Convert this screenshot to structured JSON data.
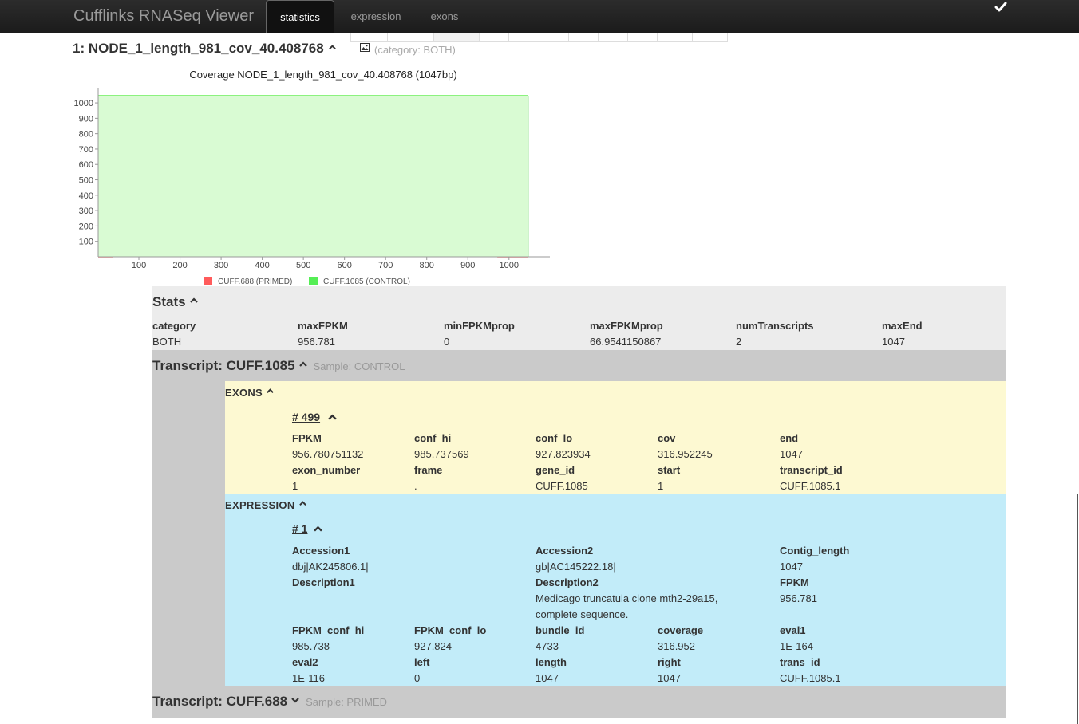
{
  "navbar": {
    "brand": "Cufflinks RNASeq Viewer",
    "tabs": [
      "statistics",
      "expression",
      "exons"
    ],
    "active_tab": "statistics",
    "check_icon": "check-icon"
  },
  "node": {
    "title": "1: NODE_1_length_981_cov_40.408768",
    "category": "(category: BOTH)"
  },
  "chart_data": {
    "type": "line",
    "title": "Coverage NODE_1_length_981_cov_40.408768 (1047bp)",
    "xlim": [
      1,
      1047
    ],
    "ylim": [
      0,
      1047
    ],
    "x_ticks": [
      100,
      200,
      300,
      400,
      500,
      600,
      700,
      800,
      900,
      1000
    ],
    "y_ticks": [
      100,
      200,
      300,
      400,
      500,
      600,
      700,
      800,
      900,
      1000
    ],
    "legend_position": "bottom",
    "series": [
      {
        "name": "CUFF.688 (PRIMED)",
        "color": "#ff5b5b",
        "x": [
          1,
          36,
          36,
          973,
          973,
          1047
        ],
        "y": [
          0,
          0,
          7,
          7,
          0,
          0
        ]
      },
      {
        "name": "CUFF.1085 (CONTROL)",
        "color": "#66ee55",
        "fill": "#d9fbd3",
        "x": [
          1,
          1047
        ],
        "y": [
          1047,
          1047
        ]
      }
    ]
  },
  "stats": {
    "heading": "Stats",
    "columns": [
      {
        "label": "category",
        "value": "BOTH"
      },
      {
        "label": "maxFPKM",
        "value": "956.781"
      },
      {
        "label": "minFPKMprop",
        "value": "0"
      },
      {
        "label": "maxFPKMprop",
        "value": "66.9541150867"
      },
      {
        "label": "numTranscripts",
        "value": "2"
      },
      {
        "label": "maxEnd",
        "value": "1047"
      }
    ]
  },
  "transcript1": {
    "title": "Transcript: CUFF.1085",
    "sample": "Sample: CONTROL",
    "exons": {
      "heading": "EXONS",
      "item": "# 499",
      "fields": [
        {
          "label": "FPKM",
          "value": "956.780751132"
        },
        {
          "label": "conf_hi",
          "value": "985.737569"
        },
        {
          "label": "conf_lo",
          "value": "927.823934"
        },
        {
          "label": "cov",
          "value": "316.952245"
        },
        {
          "label": "end",
          "value": "1047"
        },
        {
          "label": "exon_number",
          "value": "1"
        },
        {
          "label": "frame",
          "value": "."
        },
        {
          "label": "gene_id",
          "value": "CUFF.1085"
        },
        {
          "label": "start",
          "value": "1"
        },
        {
          "label": "transcript_id",
          "value": "CUFF.1085.1"
        }
      ]
    },
    "expression": {
      "heading": "EXPRESSION",
      "item": "# 1",
      "accession1": {
        "label": "Accession1",
        "value": "dbj|AK245806.1|"
      },
      "accession2": {
        "label": "Accession2",
        "value": "gb|AC145222.18|"
      },
      "contig_length": {
        "label": "Contig_length",
        "value": "1047"
      },
      "description1": {
        "label": "Description1",
        "value": ""
      },
      "description2": {
        "label": "Description2",
        "line1": "Medicago truncatula clone mth2-29a15,",
        "line2": "complete sequence."
      },
      "fpkm": {
        "label": "FPKM",
        "value": "956.781"
      },
      "fields": [
        {
          "label": "FPKM_conf_hi",
          "value": "985.738"
        },
        {
          "label": "FPKM_conf_lo",
          "value": "927.824"
        },
        {
          "label": "bundle_id",
          "value": "4733"
        },
        {
          "label": "coverage",
          "value": "316.952"
        },
        {
          "label": "eval1",
          "value": "1E-164"
        },
        {
          "label": "eval2",
          "value": "1E-116"
        },
        {
          "label": "left",
          "value": "0"
        },
        {
          "label": "length",
          "value": "1047"
        },
        {
          "label": "right",
          "value": "1047"
        },
        {
          "label": "trans_id",
          "value": "CUFF.1085.1"
        }
      ]
    }
  },
  "transcript2": {
    "title": "Transcript: CUFF.688",
    "sample": "Sample: PRIMED"
  }
}
